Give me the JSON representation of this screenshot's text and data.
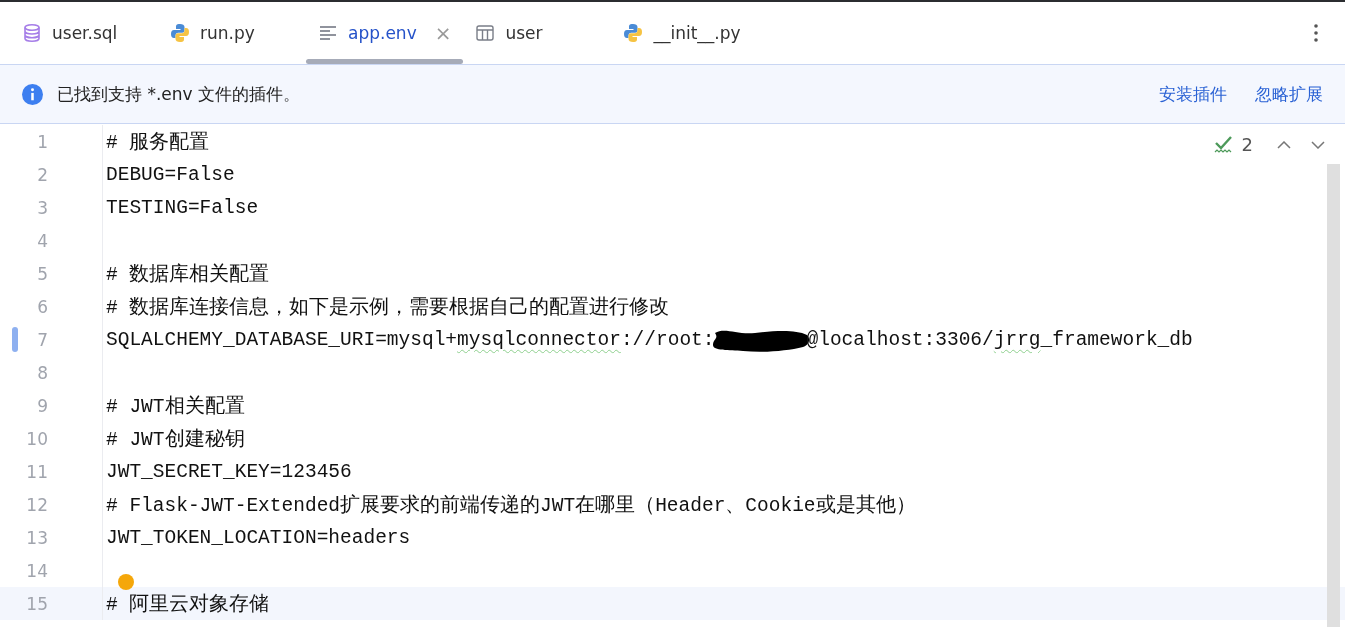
{
  "tabs": [
    {
      "label": "user.sql",
      "kind": "database",
      "selected": false,
      "closable": false
    },
    {
      "label": "run.py",
      "kind": "python",
      "selected": false,
      "closable": false
    },
    {
      "label": "app.env",
      "kind": "text",
      "selected": true,
      "closable": true
    },
    {
      "label": "user",
      "kind": "table",
      "selected": false,
      "closable": false
    },
    {
      "label": "__init__.py",
      "kind": "python",
      "selected": false,
      "closable": false
    }
  ],
  "tab_close": "×",
  "notification": {
    "message": "已找到支持 *.env 文件的插件。",
    "actions": [
      "安装插件",
      "忽略扩展"
    ]
  },
  "inspections": {
    "count": "2"
  },
  "lines": [
    {
      "number": "1",
      "text": "# 服务配置",
      "current": false,
      "modified": false
    },
    {
      "number": "2",
      "text": "DEBUG=False",
      "current": false,
      "modified": false
    },
    {
      "number": "3",
      "text": "TESTING=False",
      "current": false,
      "modified": false
    },
    {
      "number": "4",
      "current": false,
      "modified": false
    },
    {
      "number": "5",
      "text": "# 数据库相关配置",
      "current": false,
      "modified": false
    },
    {
      "number": "6",
      "text": "# 数据库连接信息，如下是示例，需要根据自己的配置进行修改",
      "current": false,
      "modified": false
    },
    {
      "number": "7",
      "segments": [
        {
          "text": "SQLALCHEMY_DATABASE_URI=mysql+",
          "typo": false
        },
        {
          "text": "mysqlconnector",
          "typo": true
        },
        {
          "text": "://root:",
          "typo": false
        },
        {
          "kind": "redaction"
        },
        {
          "text": "@localhost:3306/",
          "typo": false
        },
        {
          "text": "jrrg",
          "typo": true
        },
        {
          "text": "_framework_db",
          "typo": false
        }
      ],
      "current": false,
      "modified": true
    },
    {
      "number": "8",
      "current": false,
      "modified": false
    },
    {
      "number": "9",
      "text": "# JWT相关配置",
      "current": false,
      "modified": false
    },
    {
      "number": "10",
      "text": "# JWT创建秘钥",
      "current": false,
      "modified": false
    },
    {
      "number": "11",
      "text": "JWT_SECRET_KEY=123456",
      "current": false,
      "modified": false
    },
    {
      "number": "12",
      "text": "# Flask-JWT-Extended扩展要求的前端传递的JWT在哪里（Header、Cookie或是其他）",
      "current": false,
      "modified": false
    },
    {
      "number": "13",
      "text": "JWT_TOKEN_LOCATION=headers",
      "current": false,
      "modified": false
    },
    {
      "number": "14",
      "current": false,
      "modified": false
    },
    {
      "number": "15",
      "text": "# 阿里云对象存储",
      "current": true,
      "modified": false,
      "bulb": true
    }
  ]
}
